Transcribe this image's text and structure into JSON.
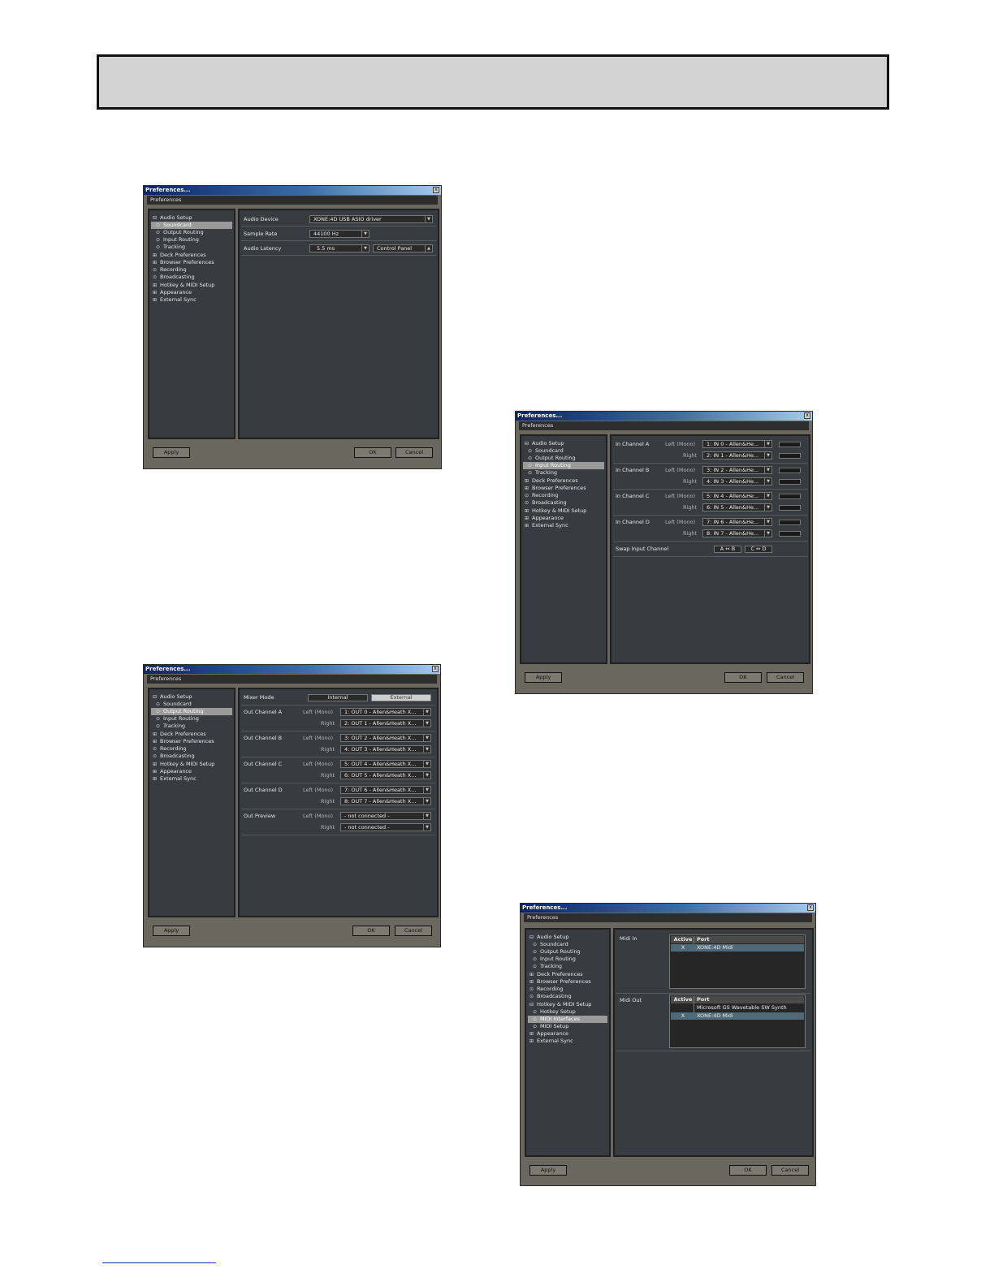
{
  "dialog_title": "Preferences...",
  "strip_label": "Preferences",
  "close_glyph": "x",
  "buttons": {
    "apply": "Apply",
    "ok": "OK",
    "cancel": "Cancel"
  },
  "tree": {
    "audio_setup": "Audio Setup",
    "soundcard": "Soundcard",
    "output_routing": "Output Routing",
    "input_routing": "Input Routing",
    "tracking": "Tracking",
    "deck_prefs": "Deck Preferences",
    "browser_prefs": "Browser Preferences",
    "recording": "Recording",
    "broadcasting": "Broadcasting",
    "hotkey_midi": "Hotkey & MIDI Setup",
    "hotkey_setup": "Hotkey Setup",
    "midi_interfaces": "MIDI Interfaces",
    "midi_setup": "MIDI Setup",
    "appearance": "Appearance",
    "external_sync": "External Sync"
  },
  "soundcard": {
    "audio_device_label": "Audio Device",
    "audio_device_value": "XONE:4D USB ASIO driver",
    "sample_rate_label": "Sample Rate",
    "sample_rate_value": "44100 Hz",
    "latency_label": "Audio Latency",
    "latency_value": "5.5 ms",
    "control_panel": "Control Panel"
  },
  "output_routing": {
    "mixer_mode_label": "Mixer Mode",
    "internal": "Internal",
    "external": "External",
    "left_mono": "Left (Mono)",
    "right": "Right",
    "channels": [
      {
        "name": "Out Channel A",
        "left": "1: OUT 0 - Allen&Heath X...",
        "right": "2: OUT 1 - Allen&Heath X..."
      },
      {
        "name": "Out Channel B",
        "left": "3: OUT 2 - Allen&Heath X...",
        "right": "4: OUT 3 - Allen&Heath X..."
      },
      {
        "name": "Out Channel C",
        "left": "5: OUT 4 - Allen&Heath X...",
        "right": "6: OUT 5 - Allen&Heath X..."
      },
      {
        "name": "Out Channel D",
        "left": "7: OUT 6 - Allen&Heath X...",
        "right": "8: OUT 7 - Allen&Heath X..."
      },
      {
        "name": "Out Preview",
        "left": "- not connected -",
        "right": "- not connected -"
      }
    ]
  },
  "input_routing": {
    "left_mono": "Left (Mono)",
    "right": "Right",
    "channels": [
      {
        "name": "In Channel A",
        "left": "1: IN 0 - Allen&He...",
        "right": "2: IN 1 - Allen&He..."
      },
      {
        "name": "In Channel B",
        "left": "3: IN 2 - Allen&He...",
        "right": "4: IN 3 - Allen&He..."
      },
      {
        "name": "In Channel C",
        "left": "5: IN 4 - Allen&He...",
        "right": "6: IN 5 - Allen&He..."
      },
      {
        "name": "In Channel D",
        "left": "7: IN 6 - Allen&He...",
        "right": "8: IN 7 - Allen&He..."
      }
    ],
    "swap_label": "Swap Input Channel",
    "swap_ab": "A ↔ B",
    "swap_cd": "C ↔ D"
  },
  "midi": {
    "midi_in_label": "Midi In",
    "midi_out_label": "Midi Out",
    "col_active": "Active",
    "col_port": "Port",
    "in_rows": [
      {
        "active": "X",
        "port": "XONE:4D Midi"
      }
    ],
    "out_rows": [
      {
        "active": "",
        "port": "Microsoft GS Wavetable SW Synth"
      },
      {
        "active": "X",
        "port": "XONE:4D Midi"
      }
    ]
  }
}
